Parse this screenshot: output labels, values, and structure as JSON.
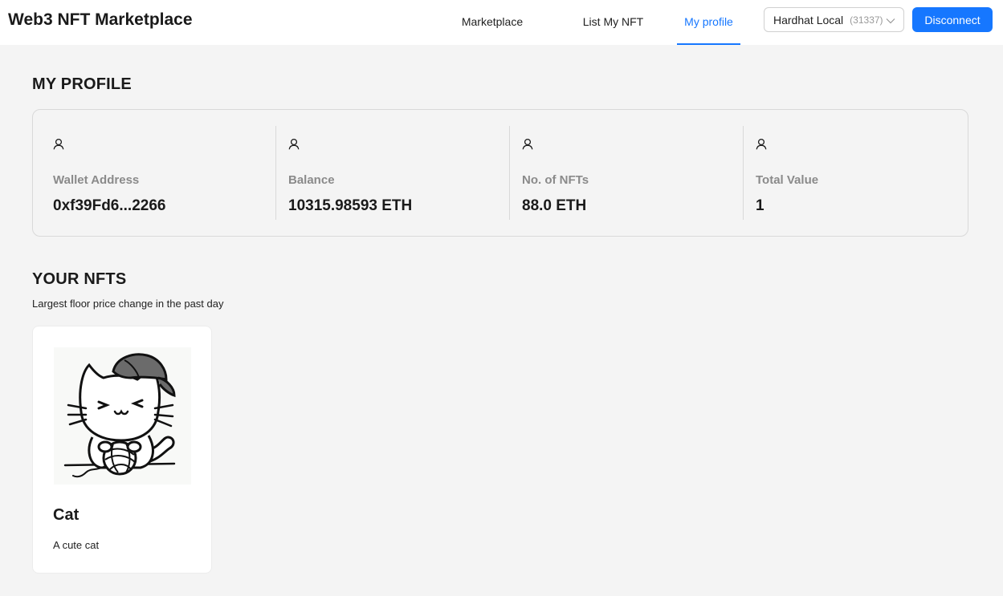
{
  "header": {
    "brand": "Web3 NFT Marketplace",
    "nav": [
      {
        "label": "Marketplace",
        "active": false
      },
      {
        "label": "List My NFT",
        "active": false
      },
      {
        "label": "My profile",
        "active": true
      }
    ],
    "network": {
      "name": "Hardhat Local",
      "chain_id": "(31337)"
    },
    "disconnect_label": "Disconnect"
  },
  "profile": {
    "title": "MY PROFILE",
    "stats": [
      {
        "icon": "user-icon",
        "label": "Wallet Address",
        "value": "0xf39Fd6...2266"
      },
      {
        "icon": "user-icon",
        "label": "Balance",
        "value": "10315.98593 ETH"
      },
      {
        "icon": "user-icon",
        "label": "No. of NFTs",
        "value": "88.0 ETH"
      },
      {
        "icon": "user-icon",
        "label": "Total Value",
        "value": "1"
      }
    ]
  },
  "nfts": {
    "title": "YOUR NFTS",
    "subtitle": "Largest floor price change in the past day",
    "items": [
      {
        "name": "Cat",
        "description": "A cute cat",
        "image": "cat-with-cap-and-yarn-illustration"
      }
    ]
  },
  "colors": {
    "accent": "#1677ff",
    "background": "#f4f4f4",
    "muted_label": "#8a8a8a"
  }
}
